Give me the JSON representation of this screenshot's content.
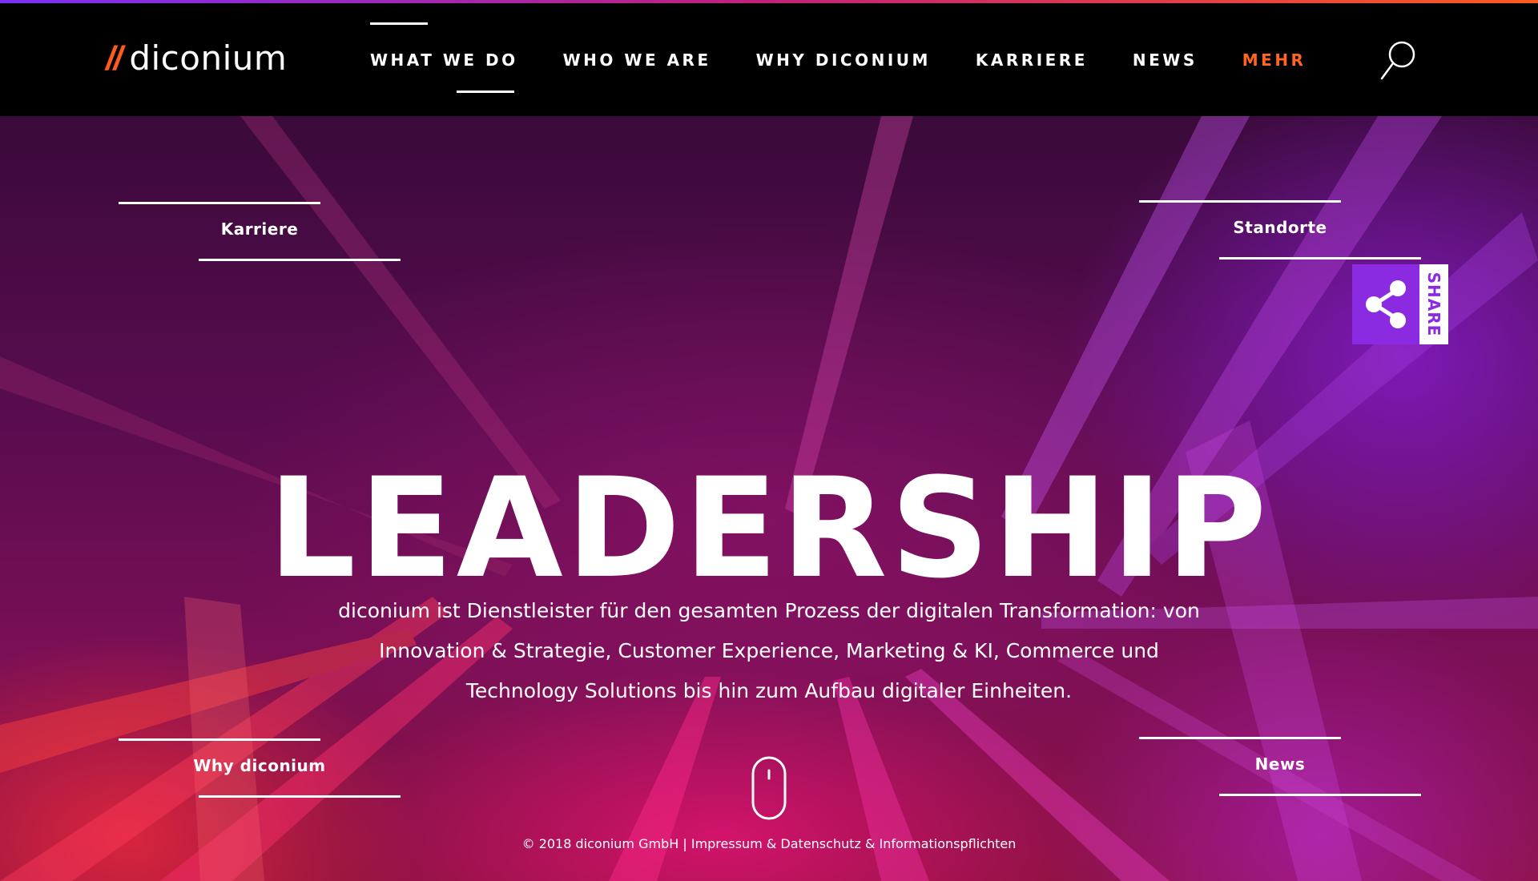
{
  "header": {
    "logo_slashes": "//",
    "logo_text": "diconium",
    "nav": [
      {
        "label": "WHAT WE DO",
        "active": true
      },
      {
        "label": "WHO WE ARE"
      },
      {
        "label": "WHY DICONIUM"
      },
      {
        "label": "KARRIERE"
      },
      {
        "label": "NEWS"
      },
      {
        "label": "MEHR",
        "accent": true
      }
    ],
    "search_icon": "search-icon"
  },
  "corner_links": {
    "top_left": "Karriere",
    "top_right": "Standorte",
    "bottom_left": "Why diconium",
    "bottom_right": "News"
  },
  "share": {
    "label": "SHARE",
    "icon": "share-icon"
  },
  "hero": {
    "headline": "LEADERSHIP",
    "description_lines": [
      "diconium ist Dienstleister für den gesamten Prozess der digitalen Transformation: von",
      "Innovation & Strategie, Customer Experience, Marketing & KI, Commerce und",
      "Technology Solutions bis hin zum Aufbau digitaler Einheiten."
    ]
  },
  "footer": {
    "copyright": "© 2018 diconium GmbH",
    "separator": "|",
    "link": "Impressum & Datenschutz & Informationspflichten"
  },
  "colors": {
    "accent_orange": "#ff5a1f",
    "share_purple": "#8a2be2",
    "header_bg": "#000000"
  }
}
